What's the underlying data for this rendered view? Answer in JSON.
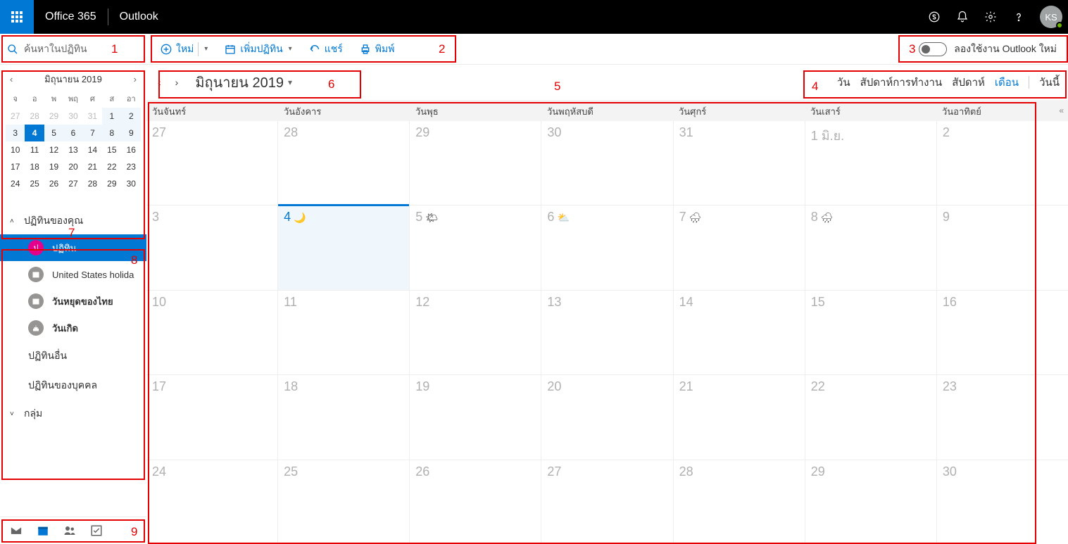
{
  "topbar": {
    "brand1": "Office 365",
    "brand2": "Outlook",
    "avatar": "KS"
  },
  "search": {
    "placeholder": "ค้นหาในปฏิทิน"
  },
  "commands": {
    "new": "ใหม่",
    "add_cal": "เพิ่มปฏิทิน",
    "share": "แชร์",
    "print": "พิมพ์"
  },
  "try_new": "ลองใช้งาน Outlook ใหม่",
  "mini": {
    "title": "มิถุนายน 2019",
    "daynames": [
      "จ",
      "อ",
      "พ",
      "พฤ",
      "ศ",
      "ส",
      "อา"
    ],
    "rows": [
      [
        {
          "n": "27",
          "dim": true
        },
        {
          "n": "28",
          "dim": true
        },
        {
          "n": "29",
          "dim": true
        },
        {
          "n": "30",
          "dim": true
        },
        {
          "n": "31",
          "dim": true
        },
        {
          "n": "1",
          "wk": true
        },
        {
          "n": "2",
          "wk": true
        }
      ],
      [
        {
          "n": "3",
          "wk": true
        },
        {
          "n": "4",
          "today": true
        },
        {
          "n": "5",
          "wk": true
        },
        {
          "n": "6",
          "wk": true
        },
        {
          "n": "7",
          "wk": true
        },
        {
          "n": "8",
          "wk": true
        },
        {
          "n": "9",
          "wk": true
        }
      ],
      [
        {
          "n": "10"
        },
        {
          "n": "11"
        },
        {
          "n": "12"
        },
        {
          "n": "13"
        },
        {
          "n": "14"
        },
        {
          "n": "15"
        },
        {
          "n": "16"
        }
      ],
      [
        {
          "n": "17"
        },
        {
          "n": "18"
        },
        {
          "n": "19"
        },
        {
          "n": "20"
        },
        {
          "n": "21"
        },
        {
          "n": "22"
        },
        {
          "n": "23"
        }
      ],
      [
        {
          "n": "24"
        },
        {
          "n": "25"
        },
        {
          "n": "26"
        },
        {
          "n": "27"
        },
        {
          "n": "28"
        },
        {
          "n": "29"
        },
        {
          "n": "30"
        }
      ]
    ]
  },
  "cal_list": {
    "header": "ปฏิทินของคุณ",
    "items": [
      {
        "label": "ปฏิทิน",
        "badge": "ป",
        "color": "#e3008c",
        "selected": true
      },
      {
        "label": "United States holida",
        "color": "#979593",
        "icon": "cal"
      },
      {
        "label": "วันหยุดของไทย",
        "color": "#979593",
        "icon": "cal",
        "bold": true
      },
      {
        "label": "วันเกิด",
        "color": "#979593",
        "icon": "cake",
        "bold": true
      }
    ],
    "other": "ปฏิทินอื่น",
    "people": "ปฏิทินของบุคคล",
    "groups": "กลุ่ม"
  },
  "main_head": {
    "title": "มิถุนายน 2019"
  },
  "views": {
    "day": "วัน",
    "workweek": "สัปดาห์การทำงาน",
    "week": "สัปดาห์",
    "month": "เดือน",
    "today": "วันนี้",
    "active": "month"
  },
  "grid": {
    "daynames": [
      "วันจันทร์",
      "วันอังคาร",
      "วันพุธ",
      "วันพฤหัสบดี",
      "วันศุกร์",
      "วันเสาร์",
      "วันอาทิตย์"
    ],
    "weeks": [
      [
        {
          "n": "27"
        },
        {
          "n": "28"
        },
        {
          "n": "29"
        },
        {
          "n": "30"
        },
        {
          "n": "31"
        },
        {
          "n": "1",
          "suffix": " มิ.ย."
        },
        {
          "n": "2"
        }
      ],
      [
        {
          "n": "3"
        },
        {
          "n": "4",
          "today": true,
          "weather": "moon"
        },
        {
          "n": "5",
          "weather": "sun"
        },
        {
          "n": "6",
          "weather": "cloud"
        },
        {
          "n": "7",
          "weather": "rain"
        },
        {
          "n": "8",
          "weather": "rain"
        },
        {
          "n": "9"
        }
      ],
      [
        {
          "n": "10"
        },
        {
          "n": "11"
        },
        {
          "n": "12"
        },
        {
          "n": "13"
        },
        {
          "n": "14"
        },
        {
          "n": "15"
        },
        {
          "n": "16"
        }
      ],
      [
        {
          "n": "17"
        },
        {
          "n": "18"
        },
        {
          "n": "19"
        },
        {
          "n": "20"
        },
        {
          "n": "21"
        },
        {
          "n": "22"
        },
        {
          "n": "23"
        }
      ],
      [
        {
          "n": "24"
        },
        {
          "n": "25"
        },
        {
          "n": "26"
        },
        {
          "n": "27"
        },
        {
          "n": "28"
        },
        {
          "n": "29"
        },
        {
          "n": "30"
        }
      ]
    ]
  },
  "annotations": {
    "labels": {
      "1": "1",
      "2": "2",
      "3": "3",
      "4": "4",
      "5": "5",
      "6": "6",
      "7": "7",
      "8": "8",
      "9": "9"
    }
  }
}
